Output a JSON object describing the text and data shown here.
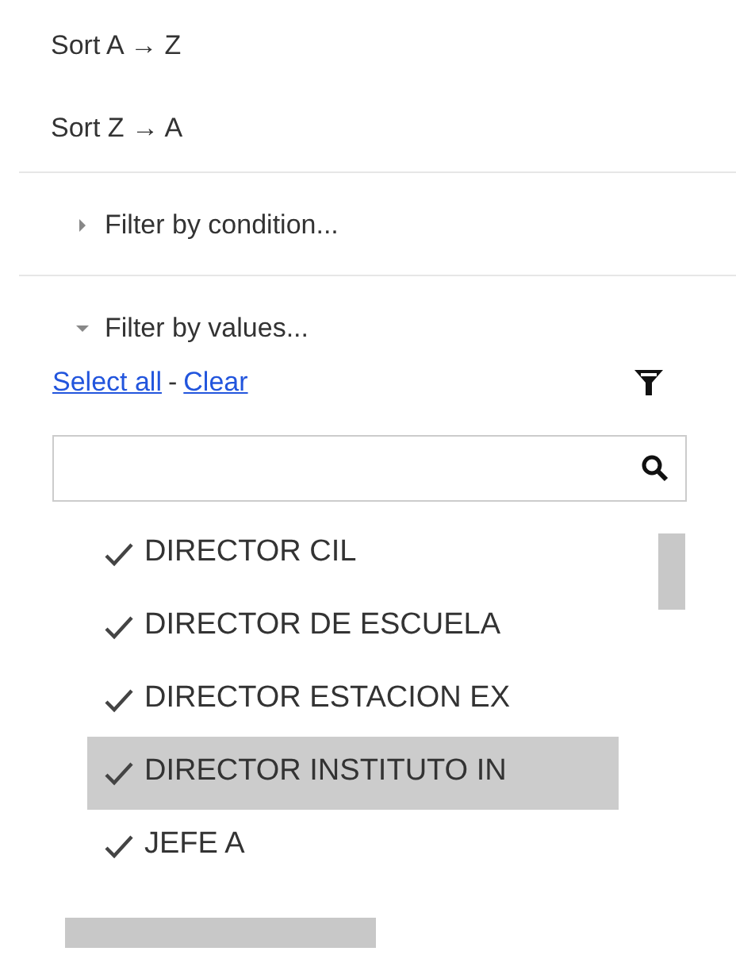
{
  "sort_options": [
    "Sort A → Z",
    "Sort Z → A"
  ],
  "sections": [
    {
      "label": "Filter by condition...",
      "expanded": false
    },
    {
      "label": "Filter by values...",
      "expanded": true
    }
  ],
  "links": {
    "select_all": "Select all",
    "separator": "-",
    "clear": "Clear"
  },
  "values": [
    {
      "label": "DIRECTOR CIL",
      "checked": true,
      "selected": false
    },
    {
      "label": "DIRECTOR DE ESCUELA",
      "checked": true,
      "selected": false
    },
    {
      "label": "DIRECTOR ESTACION EX",
      "checked": true,
      "selected": false
    },
    {
      "label": "DIRECTOR INSTITUTO IN",
      "checked": true,
      "selected": true
    },
    {
      "label": "JEFE A",
      "checked": true,
      "selected": false
    }
  ]
}
